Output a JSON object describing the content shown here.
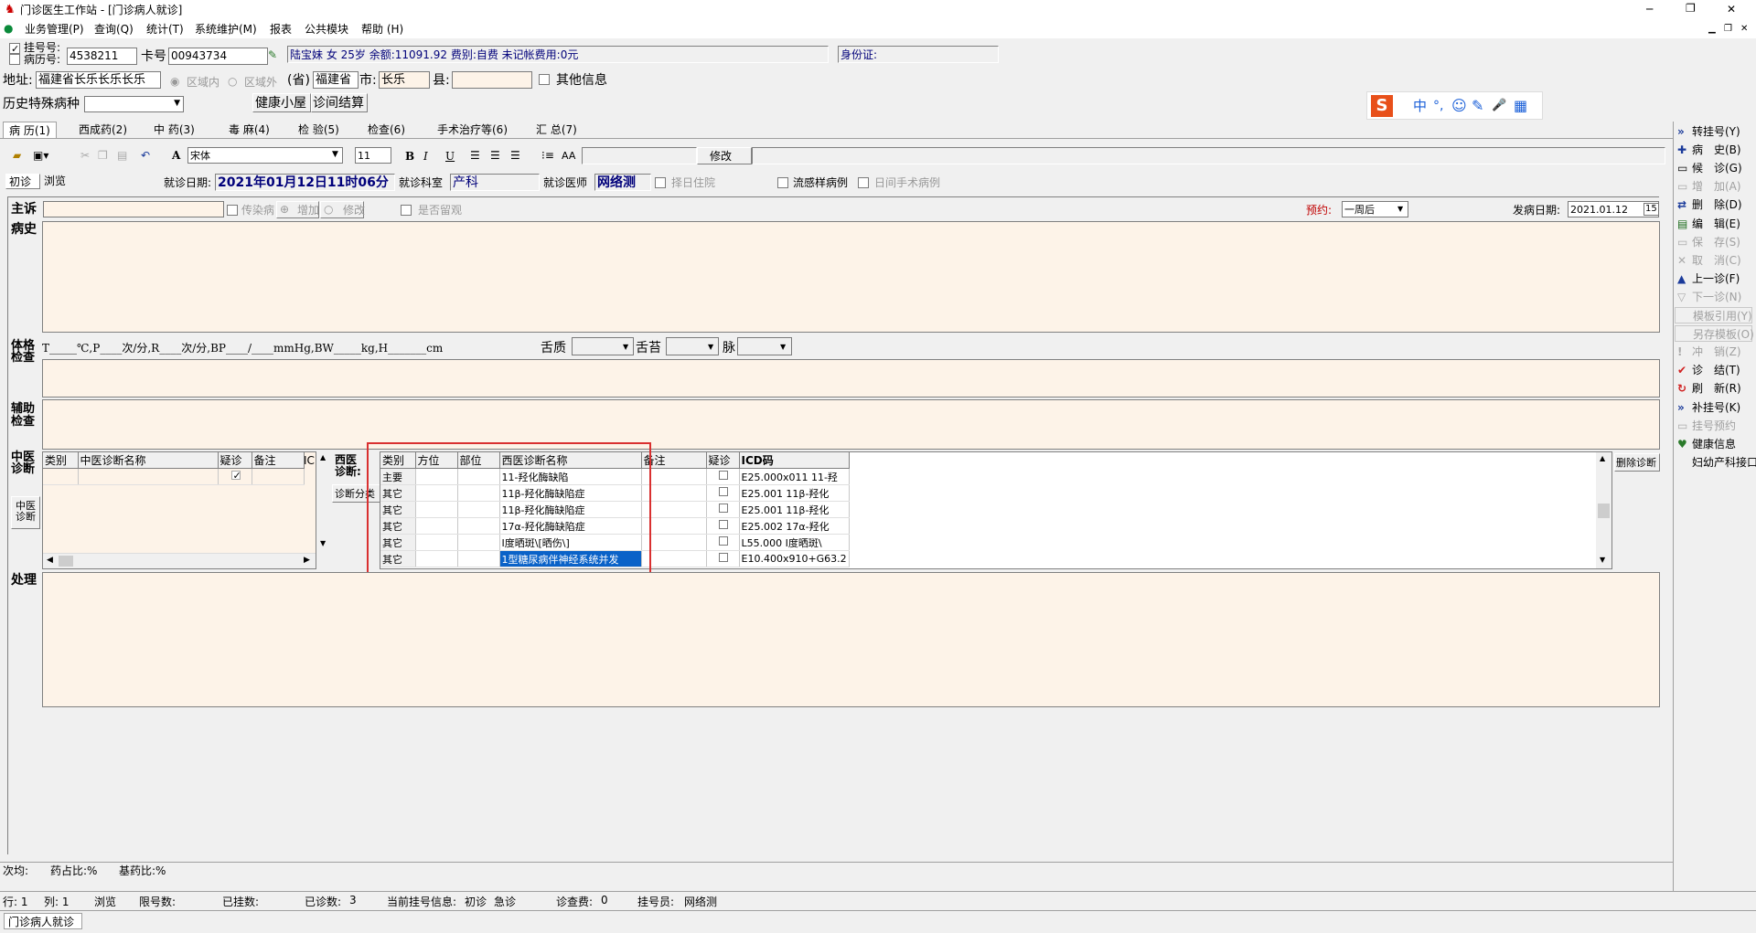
{
  "window": {
    "title": "门诊医生工作站 - [门诊病人就诊]",
    "min": "─",
    "max": "❐",
    "close": "✕"
  },
  "menu": [
    "业务管理(P)",
    "查询(Q)",
    "统计(T)",
    "系统维护(M)",
    "报表",
    "公共模块",
    "帮助 (H)"
  ],
  "patient": {
    "reg_label": "挂号号:",
    "record_label": "病历号:",
    "reg_no": "4538211",
    "card_label": "卡号",
    "card_no": "00943734",
    "info": "陆宝妹 女 25岁 余额:11091.92 费别:自费 未记帐费用:0元",
    "id_label": "身份证:"
  },
  "address": {
    "label": "地址:",
    "value": "福建省长乐长乐长乐",
    "in_area": "区域内",
    "out_area": "区域外",
    "prov_label": "(省)",
    "prov": "福建省",
    "city_label": "市:",
    "city": "长乐",
    "county_label": "县:",
    "other_info": "其他信息"
  },
  "history": {
    "label": "历史特殊病种",
    "health_btn": "健康小屋",
    "settle_btn": "诊间结算"
  },
  "ime": {
    "items": [
      "中",
      "°,",
      "☺",
      "✎",
      "🎤",
      "▦"
    ]
  },
  "tabs": [
    "病 历(1)",
    "西成药(2)",
    "中 药(3)",
    "毒 麻(4)",
    "检 验(5)",
    "检查(6)",
    "手术治疗等(6)",
    "汇 总(7)"
  ],
  "toolbar": {
    "font": "宋体",
    "size": "11",
    "bold": "B",
    "italic": "I",
    "underline": "U",
    "modify_btn": "修改"
  },
  "visit": {
    "first": "初诊",
    "browse": "浏览",
    "date_label": "就诊日期:",
    "date": "2021年01月12日11时06分",
    "dept_label": "就诊科室",
    "dept": "产科",
    "doctor_label": "就诊医师",
    "doctor": "网络测",
    "hosp": "择日住院",
    "flu": "流感样病例",
    "day_surg": "日间手术病例"
  },
  "complaint": {
    "label": "主诉",
    "infect": "传染病",
    "add": "增加",
    "edit": "修改",
    "observe": "是否留观",
    "appt_label": "预约:",
    "appt": "一周后",
    "onset_label": "发病日期:",
    "onset": "2021.01.12"
  },
  "history_label": "病史",
  "exam": {
    "label": "体格检查",
    "vitals": "T_____℃,P____次/分,R____次/分,BP____/____mmHg,BW_____kg,H_______cm",
    "tongue": "舌质",
    "coat": "舌苔",
    "pulse": "脉"
  },
  "aux_label": "辅助检查",
  "tcm": {
    "label": "中医诊断",
    "headers": [
      "类别",
      "中医诊断名称",
      "疑诊",
      "备注",
      "IC"
    ],
    "side_btn": "中医诊断"
  },
  "western": {
    "label": "西医诊断:",
    "class_btn": "诊断分类",
    "headers": [
      "类别",
      "方位",
      "部位",
      "西医诊断名称",
      "备注",
      "疑诊",
      "ICD码"
    ],
    "rows": [
      {
        "type": "主要",
        "name": "11-羟化酶缺陷",
        "icd": "E25.000x011 11-羟"
      },
      {
        "type": "其它",
        "name": "11β-羟化酶缺陷症",
        "icd": "E25.001 11β-羟化"
      },
      {
        "type": "其它",
        "name": "11β-羟化酶缺陷症",
        "icd": "E25.001 11β-羟化"
      },
      {
        "type": "其它",
        "name": "17α-羟化酶缺陷症",
        "icd": "E25.002 17α-羟化"
      },
      {
        "type": "其它",
        "name": "Ⅰ度晒斑\\[晒伤\\]",
        "icd": "L55.000 Ⅰ度晒斑\\"
      },
      {
        "type": "其它",
        "name": "1型糖尿病伴神经系统并发",
        "icd": "E10.400x910+G63.2"
      }
    ],
    "delete_btn": "删除诊断"
  },
  "treat_label": "处理",
  "right_buttons": [
    {
      "label": "转挂号(Y)",
      "icon": "»",
      "dis": false
    },
    {
      "label": "病　史(B)",
      "icon": "✚",
      "dis": false
    },
    {
      "label": "候　诊(G)",
      "icon": "▭",
      "dis": false
    },
    {
      "label": "增　加(A)",
      "icon": "▭",
      "dis": true
    },
    {
      "label": "删　除(D)",
      "icon": "⇄",
      "dis": false
    },
    {
      "label": "编　辑(E)",
      "icon": "▤",
      "dis": false
    },
    {
      "label": "保　存(S)",
      "icon": "▭",
      "dis": true
    },
    {
      "label": "取　消(C)",
      "icon": "✕",
      "dis": true
    },
    {
      "label": "上一诊(F)",
      "icon": "▲",
      "dis": false
    },
    {
      "label": "下一诊(N)",
      "icon": "▽",
      "dis": true
    },
    {
      "label": "模板引用(Y)",
      "icon": "",
      "dis": true
    },
    {
      "label": "另存模板(O)",
      "icon": "",
      "dis": true
    },
    {
      "label": "冲　销(Z)",
      "icon": "!",
      "dis": true
    },
    {
      "label": "诊　结(T)",
      "icon": "✔",
      "dis": false
    },
    {
      "label": "刷　新(R)",
      "icon": "↻",
      "dis": false
    },
    {
      "label": "补挂号(K)",
      "icon": "»",
      "dis": false
    },
    {
      "label": "挂号预约",
      "icon": "▭",
      "dis": true
    },
    {
      "label": "健康信息",
      "icon": "♥",
      "dis": false
    },
    {
      "label": "妇幼产科接口",
      "icon": "",
      "dis": false
    }
  ],
  "stats": {
    "avg": "次均:",
    "drug": "药占比:%",
    "base": "基药比:%"
  },
  "status": {
    "row": "行:  1",
    "col": "列:  1",
    "browse": "浏览",
    "limit": "限号数:",
    "reg": "已挂数:",
    "seen_label": "已诊数:",
    "seen": "3",
    "cur_label": "当前挂号信息:",
    "cur_first": "初诊",
    "cur_type": "急诊",
    "fee_label": "诊查费:",
    "fee": "0",
    "op_label": "挂号员:",
    "op": "网络测"
  },
  "taskbar": "门诊病人就诊",
  "colors": {
    "highlight": "#0a62c8",
    "pink": "#fdf3e8",
    "redbox": "#d93030"
  }
}
